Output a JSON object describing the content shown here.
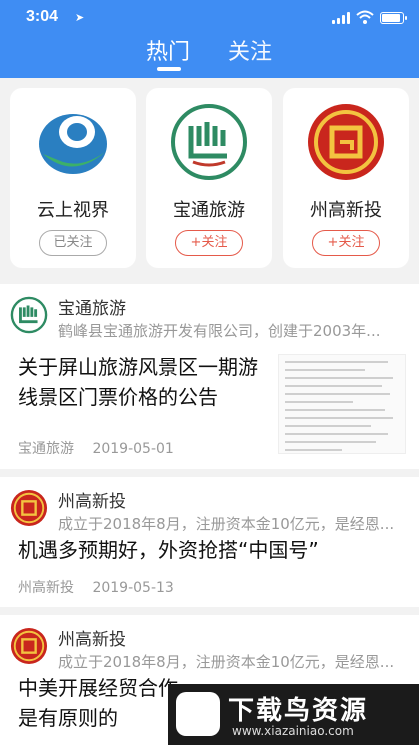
{
  "status": {
    "time": "3:04"
  },
  "tabs": {
    "hot": "热门",
    "follow": "关注"
  },
  "cards": [
    {
      "name": "云上视界",
      "button": "已关注",
      "followed": true
    },
    {
      "name": "宝通旅游",
      "button": "+关注",
      "followed": false
    },
    {
      "name": "州高新投",
      "button": "+关注",
      "followed": false
    }
  ],
  "feed": [
    {
      "source": "宝通旅游",
      "desc": "鹤峰县宝通旅游开发有限公司，创建于2003年...",
      "title": "关于屏山旅游风景区一期游线景区门票价格的公告",
      "author": "宝通旅游",
      "date": "2019-05-01"
    },
    {
      "source": "州高新投",
      "desc": "成立于2018年8月，注册资本金10亿元，是经恩...",
      "title": "机遇多预期好，外资抢搭“中国号”",
      "author": "州高新投",
      "date": "2019-05-13"
    },
    {
      "source": "州高新投",
      "desc": "成立于2018年8月，注册资本金10亿元，是经恩...",
      "title": "中美开展经贸合作是有原则的"
    }
  ],
  "watermark": {
    "text": "下载鸟资源",
    "url": "www.xiazainiao.com"
  },
  "colors": {
    "header": "#3f8df3",
    "follow": "#e55a4a"
  }
}
